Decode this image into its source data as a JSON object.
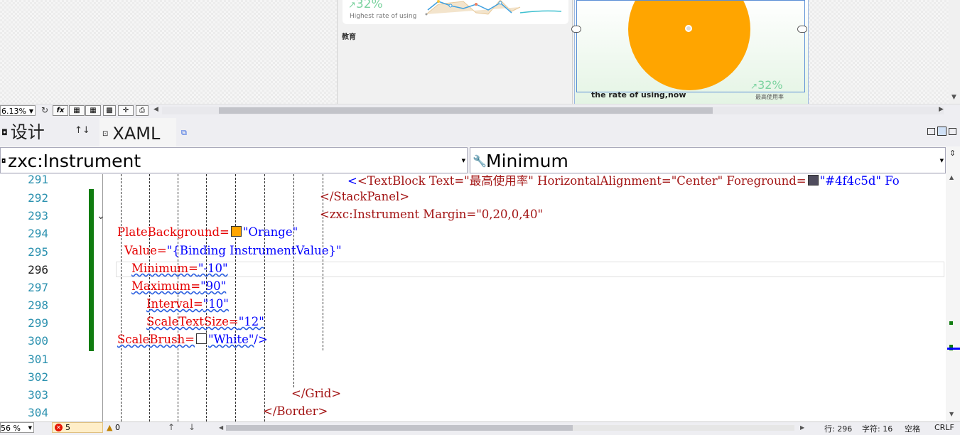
{
  "designer": {
    "card1_percent": "32%",
    "card1_caption": "Highest rate of using",
    "card1_category": "教育",
    "card2_title": "the rate of using,now",
    "card2_percent": "32%",
    "card2_caption": "最高使用率",
    "plate_color": "#ffa500"
  },
  "toolbar": {
    "zoom": "6.13%",
    "buttons": [
      "fx",
      "grid",
      "grid2",
      "grid3",
      "checker",
      "snap",
      "refresh"
    ]
  },
  "tabs": {
    "design": "设计",
    "swap_icon": "↑↓",
    "xaml": "XAML"
  },
  "nav": {
    "element": "zxc:Instrument",
    "member": "Minimum"
  },
  "editor": {
    "line_numbers": [
      "291",
      "292",
      "293",
      "294",
      "295",
      "296",
      "297",
      "298",
      "299",
      "300",
      "301",
      "302",
      "303",
      "304"
    ],
    "current_line": "296",
    "lines": {
      "l291": "<TextBlock Text=\"最高使用率\" HorizontalAlignment=\"Center\" Foreground=",
      "l291_value": "\"#4f4c5d\" Fo",
      "l292": "</StackPanel>",
      "l293": "<zxc:Instrument Margin=\"0,20,0,40\"",
      "l294_attr": "PlateBackground=",
      "l294_value": "\"Orange\"",
      "l295_attr": "Value=",
      "l295_value": "\"{Binding InstrumentValue}\"",
      "l296_attr": "Minimum=",
      "l296_value": "\"-10\"",
      "l297_attr": "Maximum=",
      "l297_value": "\"90\"",
      "l298_attr": "Interval=",
      "l298_value": "\"10\"",
      "l299_attr": "ScaleTextSize=",
      "l299_value": "\"12\"",
      "l300_attr": "ScaleBrush=",
      "l300_value": "\"White\"",
      "l300_end": "/>",
      "l303": "</Grid>",
      "l304": "</Border>"
    }
  },
  "status": {
    "zoom": "56 %",
    "errors": "5",
    "warnings": "0",
    "line": "行: 296",
    "char": "字符: 16",
    "spaces": "空格",
    "eol": "CRLF"
  }
}
